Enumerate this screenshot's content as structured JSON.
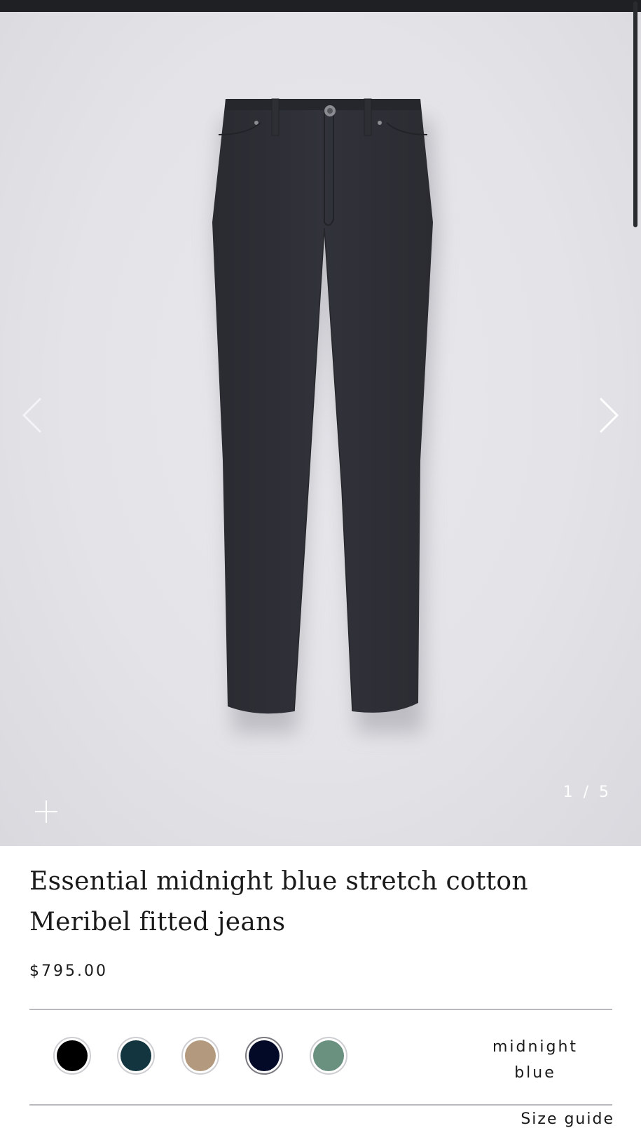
{
  "gallery": {
    "counter": "1 / 5",
    "image_alt": "product-image-jeans",
    "prev_icon": "chevron-left-icon",
    "next_icon": "chevron-right-icon",
    "zoom_icon": "plus-icon"
  },
  "product": {
    "title": "Essential midnight blue stretch cotton Meribel fitted jeans",
    "price": "$795.00"
  },
  "colors": {
    "selected_name": "midnight blue",
    "swatches": [
      {
        "name": "black",
        "hex": "#000000"
      },
      {
        "name": "teal",
        "hex": "#12353f"
      },
      {
        "name": "beige",
        "hex": "#b39a7e"
      },
      {
        "name": "midnight blue",
        "hex": "#030a28"
      },
      {
        "name": "sage green",
        "hex": "#6a9080"
      }
    ]
  },
  "size_guide": {
    "label": "Size guide"
  }
}
